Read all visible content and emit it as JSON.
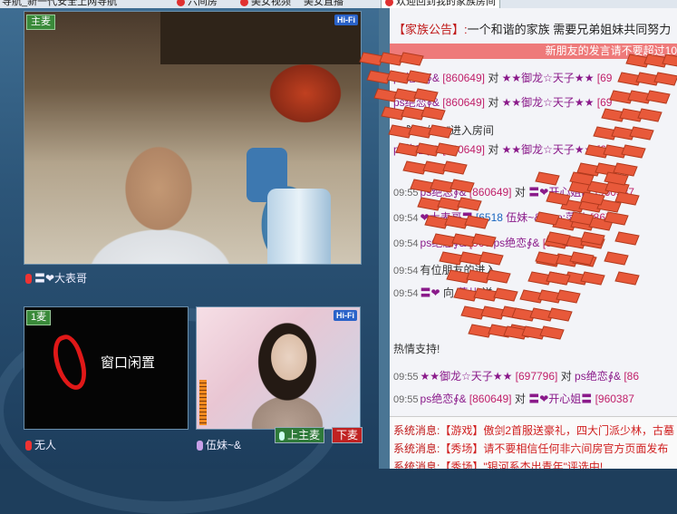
{
  "browser": {
    "tabs": [
      {
        "label": "导航_新一代安全上网导航",
        "active": false
      },
      {
        "label": "六间房",
        "active": false
      },
      {
        "label": "美女视频",
        "active": false
      },
      {
        "label": "美女直播",
        "active": false
      },
      {
        "label": "欢迎回到我的家族房间",
        "active": true
      }
    ]
  },
  "video": {
    "main": {
      "mic_badge": "主麦",
      "hifi": "Hi-Fi",
      "user": "〓❤大表哥"
    },
    "slot1": {
      "mic_badge": "1麦",
      "idle_text": "窗口闲置",
      "user": "无人"
    },
    "slot2": {
      "hifi": "Hi-Fi",
      "user": "伍妹~&"
    },
    "buttons": {
      "up_mic": "上主麦",
      "down_mic": "下麦"
    }
  },
  "chat": {
    "notice_label": "【家族公告】:",
    "notice_text": "一个和谐的家族  需要兄弟姐妹共同努力",
    "marquee": "新朋友的发言请不要超过10",
    "lines": [
      {
        "time": "",
        "parts": [
          {
            "c": "nick",
            "t": "ps绝恋∮&"
          },
          {
            "c": "id",
            "t": "[860649]"
          },
          {
            "c": "",
            "t": "对"
          },
          {
            "c": "star",
            "t": "★★御龙☆天子★★"
          },
          {
            "c": "id",
            "t": "[69"
          }
        ]
      },
      {
        "time": "",
        "parts": [
          {
            "c": "nick",
            "t": "ps绝恋∮&"
          },
          {
            "c": "id",
            "t": "[860649]"
          },
          {
            "c": "",
            "t": "对"
          },
          {
            "c": "star",
            "t": "★★御龙☆天子★★"
          },
          {
            "c": "id",
            "t": "[69"
          }
        ]
      },
      {
        "time": "",
        "parts": [
          {
            "c": "",
            "t": "“❤随☀缘❤”进入房间"
          }
        ]
      },
      {
        "time": "",
        "parts": [
          {
            "c": "nick",
            "t": "ps绝恋∮&"
          },
          {
            "c": "id",
            "t": "[860649]"
          },
          {
            "c": "",
            "t": "对"
          },
          {
            "c": "star",
            "t": "★★御龙☆天子★★"
          },
          {
            "c": "id",
            "t": "[69"
          }
        ]
      },
      {
        "time": "09:55",
        "parts": [
          {
            "c": "nick",
            "t": "ps绝恋∮&"
          },
          {
            "c": "id",
            "t": "[860649]"
          },
          {
            "c": "",
            "t": "对"
          },
          {
            "c": "nick",
            "t": "〓❤开心姐〓"
          },
          {
            "c": "id",
            "t": "[960387"
          }
        ]
      },
      {
        "time": "09:54",
        "parts": [
          {
            "c": "nick",
            "t": "❤大表哥〓"
          },
          {
            "c": "id blue",
            "t": "[6518"
          },
          {
            "c": "nick",
            "t": "伍妹~&amp;萍儿"
          },
          {
            "c": "id",
            "t": "[8671"
          }
        ]
      },
      {
        "time": "09:54",
        "parts": [
          {
            "c": "nick",
            "t": "ps绝恋∮&"
          },
          {
            "c": "id",
            "t": "[960"
          },
          {
            "c": "nick",
            "t": "ps绝恋∮&"
          },
          {
            "c": "id",
            "t": "[860649"
          }
        ]
      },
      {
        "time": "09:54",
        "parts": [
          {
            "c": "",
            "t": "有位朋友的进入"
          }
        ]
      },
      {
        "time": "09:54",
        "parts": [
          {
            "c": "nick",
            "t": "〓❤"
          },
          {
            "c": "",
            "t": "向"
          },
          {
            "c": "nick",
            "t": "萍儿"
          },
          {
            "c": "",
            "t": "送"
          }
        ]
      },
      {
        "time": "",
        "parts": [
          {
            "c": "",
            "t": "热情支持!"
          }
        ]
      },
      {
        "time": "09:55",
        "parts": [
          {
            "c": "star",
            "t": "★★御龙☆天子★★"
          },
          {
            "c": "id",
            "t": "[697796]"
          },
          {
            "c": "",
            "t": "对"
          },
          {
            "c": "nick",
            "t": "ps绝恋∮&"
          },
          {
            "c": "id",
            "t": "[86"
          }
        ]
      },
      {
        "time": "09:55",
        "parts": [
          {
            "c": "nick",
            "t": "ps绝恋∮&"
          },
          {
            "c": "id",
            "t": "[860649]"
          },
          {
            "c": "",
            "t": "对"
          },
          {
            "c": "nick",
            "t": "〓❤开心姐〓"
          },
          {
            "c": "id",
            "t": "[960387"
          }
        ]
      }
    ],
    "system": [
      {
        "tag": "系统消息:",
        "msg": "【游戏】傲剑2首服送豪礼，四大门派少林，古墓"
      },
      {
        "tag": "系统消息:",
        "msg": "【秀场】请不要相信任何非六间房官方页面发布"
      },
      {
        "tag": "系统消息:",
        "msg": "【秀场】\"银河系杰出青年\"评选中!"
      }
    ]
  },
  "colors": {
    "accent_red": "#c01818",
    "nick_purple": "#8a1a8a",
    "id_pink": "#c0206a",
    "overlay_orange": "#e8593a"
  }
}
